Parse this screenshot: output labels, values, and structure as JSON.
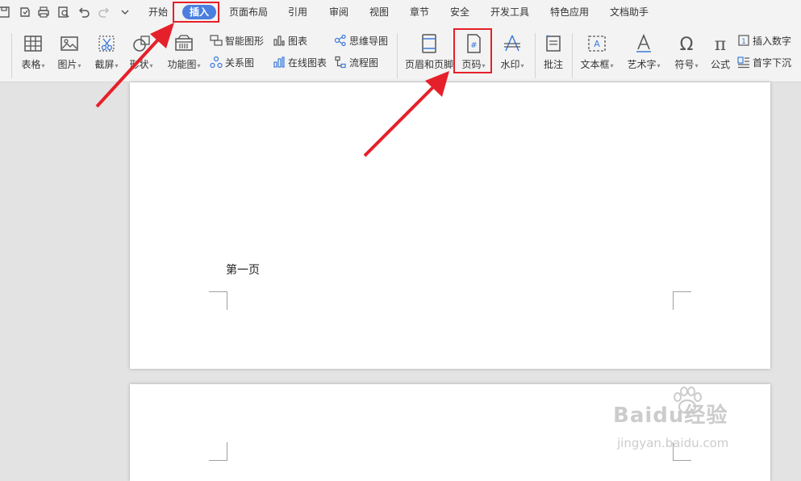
{
  "menubar": {
    "tabs": [
      {
        "label": "开始"
      },
      {
        "label": "插入"
      },
      {
        "label": "页面布局"
      },
      {
        "label": "引用"
      },
      {
        "label": "审阅"
      },
      {
        "label": "视图"
      },
      {
        "label": "章节"
      },
      {
        "label": "安全"
      },
      {
        "label": "开发工具"
      },
      {
        "label": "特色应用"
      },
      {
        "label": "文档助手"
      }
    ],
    "active_tab": "插入"
  },
  "ribbon": {
    "table": "表格",
    "picture": "图片",
    "screenshot": "截屏",
    "shape": "形状",
    "function_chart": "功能图",
    "smart_graphic": "智能图形",
    "chart": "图表",
    "mind_map": "思维导图",
    "relation_chart": "关系图",
    "online_chart": "在线图表",
    "flowchart": "流程图",
    "header_footer": "页眉和页脚",
    "page_number": "页码",
    "watermark": "水印",
    "comment": "批注",
    "text_box": "文本框",
    "art_text": "艺术字",
    "symbol": "符号",
    "formula": "公式",
    "insert_number": "插入数字",
    "drop_cap": "首字下沉"
  },
  "document": {
    "page1_text": "第一页"
  },
  "watermark": {
    "brand": "Baidu经验",
    "url": "jingyan.baidu.com"
  },
  "colors": {
    "accent": "#4a7fe0",
    "highlight": "#e5202a",
    "arrow": "#e5202a"
  }
}
